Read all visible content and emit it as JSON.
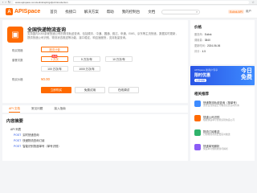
{
  "browser": {
    "url": "www.apispace.com/eolink/api/zgsfjxc/introduction"
  },
  "nav": {
    "logo_mark": "A",
    "logo_text": "APISpace",
    "items": [
      "首页",
      "找接口",
      "解决方案",
      "帮助",
      "我的控制台",
      "文档"
    ],
    "search_icon": "search-icon",
    "user_pill": "Eolink API",
    "user_name": "用户"
  },
  "api": {
    "title": "全国快递物流查询",
    "description": "支持国内2000余家快递公司的物流轨迹查询，包括顺丰、中通、圆通、韵达、申通、EMS、京东等主流快递，数据实时更新，提供快递公司识别、物流状态推送等功能，接口稳定，响应速度快，支持批量查询。",
    "rows": [
      {
        "label": "购买规格"
      },
      {
        "label": "套餐次数"
      },
      {
        "label": "购买价格"
      }
    ],
    "spec_options": [
      "按次计费"
    ],
    "count_options": [
      {
        "text": "1 万次",
        "badge": "热销"
      },
      {
        "text": "5 万次/年"
      },
      {
        "text": "10 万次/年"
      },
      {
        "text": "100 万次/年"
      },
      {
        "text": "1000 万次/年"
      }
    ],
    "price": "¥0.00",
    "buttons": {
      "buy": "立即购买",
      "trial": "免费试用",
      "test": "在线调试"
    }
  },
  "detail": {
    "title": "价格",
    "lines": [
      {
        "k": "服务商：",
        "v": "Eolink"
      },
      {
        "k": "调用量：",
        "v": "3840"
      },
      {
        "k": "更新时间：",
        "v": "2024-06-06"
      },
      {
        "k": "评分：",
        "v": "4.5"
      }
    ]
  },
  "promo": {
    "sub": "APISpace 新用户专享",
    "main": "限时优惠",
    "btn": "立即领取",
    "big": "今日\n免费"
  },
  "related": {
    "title": "相关推荐",
    "items": [
      {
        "name": "快递物流轨迹查询（按单号）",
        "desc": "支持主流快递公司物流信息实时查询",
        "color": "#3d8bff"
      },
      {
        "name": "快递公司识别",
        "desc": "根据快递单号智能识别快递公司",
        "color": "#ff6a00"
      },
      {
        "name": "物流订阅推送",
        "desc": "订阅物流状态变更实时推送",
        "color": "#2fb36b"
      },
      {
        "name": "快递单号解析",
        "desc": "快递单号规则校验与解析",
        "color": "#8b5cf6"
      }
    ]
  },
  "tabs": [
    "API 文档",
    "常见问题",
    "接入指南"
  ],
  "content": {
    "title": "内容摘要",
    "sub": "API 列表",
    "endpoints": [
      {
        "method": "POST",
        "name": "实时快递查询"
      },
      {
        "method": "POST",
        "name": "快递物流查询订阅"
      },
      {
        "method": "POST",
        "name": "智能识别快递单号（单号识别）"
      }
    ]
  }
}
